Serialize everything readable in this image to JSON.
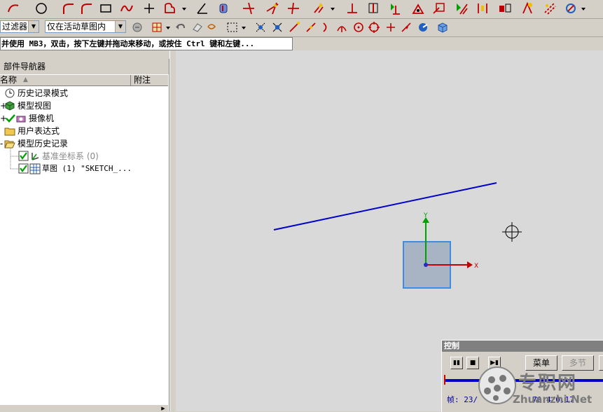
{
  "toolbar_top": {
    "icons": [
      "arc-icon",
      "circle-icon",
      "fillet-icon",
      "rectangle-icon",
      "studio-spline-icon",
      "point-icon",
      "profile-icon",
      "dropdown-arrow-icon",
      "angle-dimension-icon",
      "cylinder-icon",
      "trim-icon",
      "extend-icon",
      "corner-icon",
      "quick-edit-icon",
      "dropdown-arrow-icon",
      "perpendicular-constraint-icon",
      "horizontal-constraint-icon",
      "vertical-constraint-icon",
      "inferred-dimension-icon",
      "show-constraints-icon",
      "show-no-constraints-icon",
      "constraint-display-icon",
      "alternate-solution-icon",
      "inferred-settings-icon",
      "convert-reference-icon",
      "more-icon"
    ]
  },
  "toolbar_second": {
    "filter_label": "过滤器",
    "scope_label": "仅在活动草图内",
    "icons": [
      "select-icon",
      "snap-icon",
      "undo-icon",
      "redo-icon",
      "rectangle-select-icon",
      "point-snap-icon",
      "grid-snap-icon",
      "line-icon",
      "arc-icon",
      "tangent-icon",
      "intersection-icon",
      "center-icon",
      "quadrant-icon",
      "existing-point-icon",
      "point-on-curve-icon",
      "view-cube-icon"
    ]
  },
  "cue_line": "并使用 MB3，双击，按下左键并拖动来移动，或按住 Ctrl 键和左键...",
  "navigator": {
    "title": "部件导航器",
    "col_name": "名称",
    "col_note": "附注",
    "items": [
      {
        "label": "历史记录模式",
        "icon": "clock-icon"
      },
      {
        "label": "模型视图",
        "icon": "model-views-icon"
      },
      {
        "label": "摄像机",
        "icon": "camera-icon"
      },
      {
        "label": "用户表达式",
        "icon": "folder-icon"
      },
      {
        "label": "模型历史记录",
        "icon": "folder-open-icon"
      },
      {
        "label": "基准坐标系 (0)",
        "icon": "datum-csys-icon"
      },
      {
        "label": "草图 (1) \"SKETCH_...",
        "icon": "sketch-icon"
      }
    ]
  },
  "canvas": {
    "axis_x": "X",
    "axis_y": "Y"
  },
  "control_panel": {
    "title": "控制",
    "menu_btn": "菜单",
    "multi_btn": "多节",
    "frame_text": "帧: 23/",
    "frame_text2": "70.4/0.17"
  },
  "watermark": {
    "title": "专职网",
    "url": "Zhuanzhi.Net"
  },
  "colors": {
    "canvas_bg": "#d9d9d9",
    "sketch_line": "#0000c8",
    "csys_x": "#c00000",
    "csys_y": "#00a000",
    "highlight_square": "#4090d8"
  }
}
